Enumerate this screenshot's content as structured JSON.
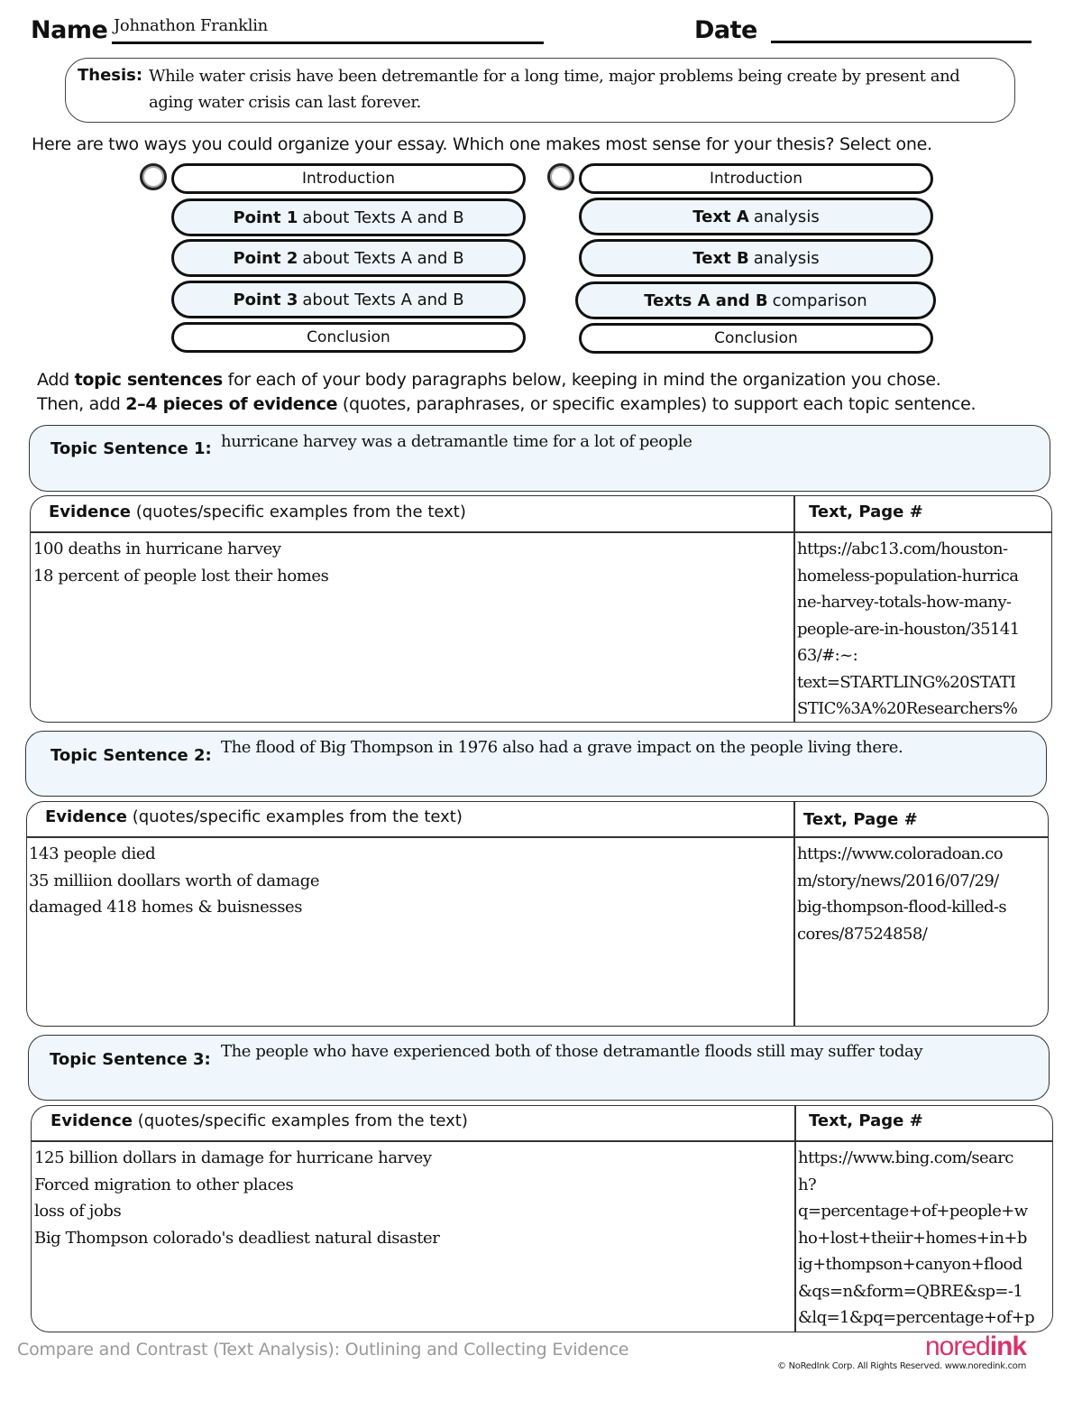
{
  "header": {
    "name_label": "Name",
    "name_value": "Johnathon Franklin",
    "date_label": "Date",
    "date_value": ""
  },
  "thesis": {
    "label": "Thesis:",
    "text": "While water crisis have been detremantle for a long time, major problems being create by present and aging water crisis can last forever."
  },
  "prompt": "Here are two ways you could organize your essay. Which one makes most sense for your thesis? Select one.",
  "options": [
    {
      "selected": false,
      "items": [
        {
          "bold": "",
          "text": "Introduction"
        },
        {
          "bold": "Point 1",
          "text": "about Texts A and B"
        },
        {
          "bold": "Point 2",
          "text": "about Texts A and B"
        },
        {
          "bold": "Point 3",
          "text": "about Texts A and B"
        },
        {
          "bold": "",
          "text": "Conclusion"
        }
      ]
    },
    {
      "selected": false,
      "items": [
        {
          "bold": "",
          "text": "Introduction"
        },
        {
          "bold": "Text A",
          "text": "analysis"
        },
        {
          "bold": "Text B",
          "text": "analysis"
        },
        {
          "bold": "Texts A and B",
          "text": "comparison"
        },
        {
          "bold": "",
          "text": "Conclusion"
        }
      ]
    }
  ],
  "instructions": {
    "line1_pre": "Add ",
    "line1_bold": "topic sentences",
    "line1_post": " for each of your body paragraphs below, keeping in mind the organization you chose.",
    "line2_pre": "Then, add ",
    "line2_bold": "2–4 pieces of evidence",
    "line2_post": " (quotes, paraphrases, or specific examples) to support each topic sentence."
  },
  "evidence_header": {
    "bold": "Evidence",
    "rest": " (quotes/specific examples from the text)",
    "source": "Text, Page #"
  },
  "sections": [
    {
      "topic_label": "Topic Sentence 1:",
      "topic_text": "hurricane harvey was a detramantle time for a lot of people",
      "evidence": [
        "100 deaths in hurricane harvey",
        "18 percent of people lost their homes"
      ],
      "source": "https://abc13.com/houston-\nhomeless-population-hurrica\nne-harvey-totals-how-many-\npeople-are-in-houston/35141\n63/#:~:\ntext=STARTLING%20STATI\nSTIC%3A%20Researchers%"
    },
    {
      "topic_label": "Topic Sentence 2:",
      "topic_text": "The flood of Big Thompson in 1976 also had a grave impact on the people living there.",
      "evidence": [
        "143 people died",
        "35 milliion doollars worth of damage",
        "damaged 418 homes & buisnesses"
      ],
      "source": "https://www.coloradoan.co\nm/story/news/2016/07/29/\nbig-thompson-flood-killed-s\ncores/87524858/"
    },
    {
      "topic_label": "Topic Sentence 3:",
      "topic_text": "The people who have experienced both of those detramantle floods still may suffer today",
      "evidence": [
        "125 billion dollars in damage for hurricane harvey",
        "Forced migration to other places",
        "loss of jobs",
        "Big Thompson colorado's deadliest natural disaster"
      ],
      "source": "https://www.bing.com/searc\nh?\nq=percentage+of+people+w\nho+lost+theiir+homes+in+b\nig+thompson+canyon+flood\n&qs=n&form=QBRE&sp=-1\n&lq=1&pq=percentage+of+p"
    }
  ],
  "footer": {
    "title": "Compare and Contrast (Text Analysis): Outlining and Collecting Evidence",
    "logo_part1": "nored",
    "logo_part2": "ink",
    "copyright": "© NoRedInk Corp. All Rights Reserved. www.noredink.com"
  },
  "colors": {
    "accent_blue_fill": "#eef6fb",
    "logo_pink": "#d6336c",
    "footer_gray": "#999999"
  }
}
